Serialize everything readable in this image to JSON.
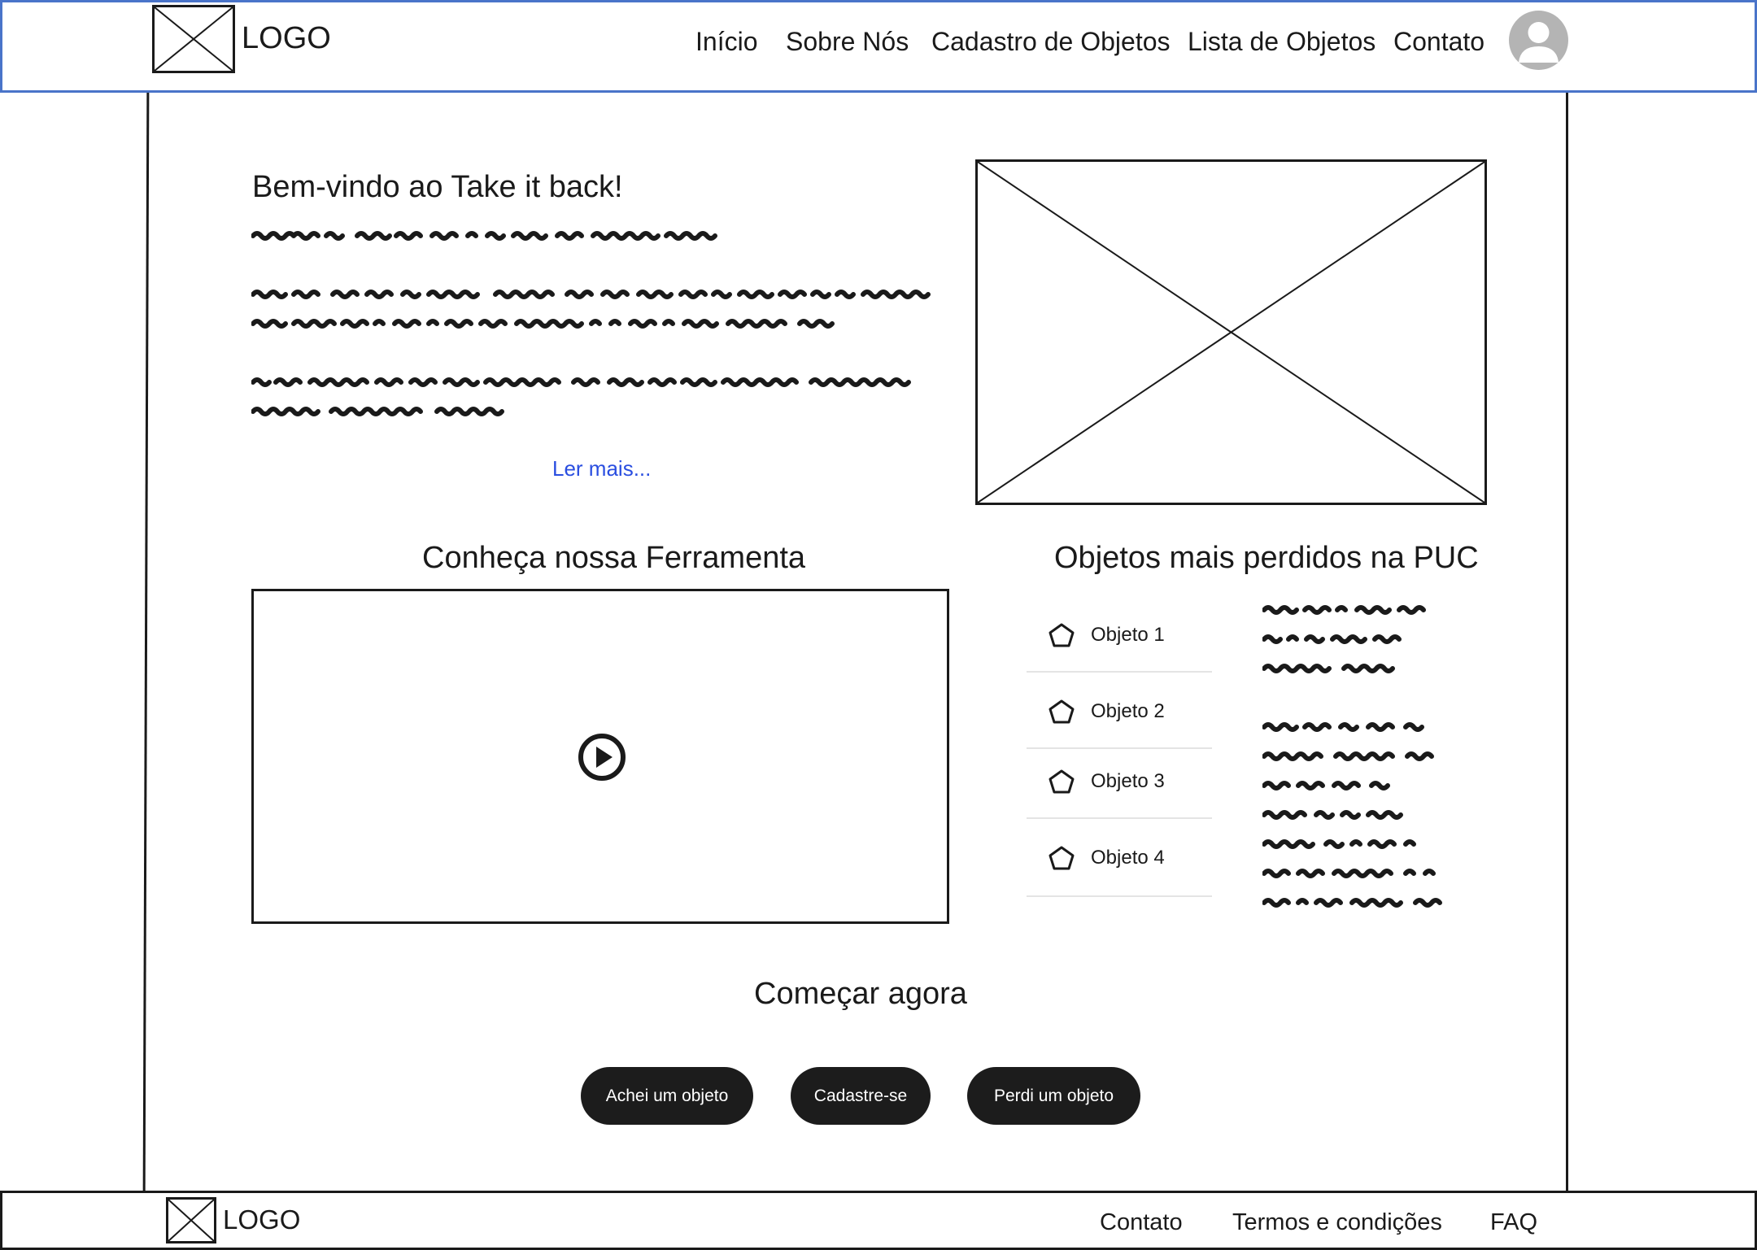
{
  "header": {
    "logo_text": "LOGO",
    "nav": [
      {
        "label": "Início"
      },
      {
        "label": "Sobre Nós"
      },
      {
        "label": "Cadastro de Objetos"
      },
      {
        "label": "Lista de Objetos"
      },
      {
        "label": "Contato"
      }
    ]
  },
  "hero": {
    "title": "Bem-vindo ao Take it back!",
    "read_more": "Ler mais..."
  },
  "tool_section": {
    "title": "Conheça nossa Ferramenta"
  },
  "lost_section": {
    "title": "Objetos mais perdidos na PUC",
    "items": [
      {
        "label": "Objeto 1"
      },
      {
        "label": "Objeto 2"
      },
      {
        "label": "Objeto 3"
      },
      {
        "label": "Objeto 4"
      }
    ]
  },
  "cta": {
    "title": "Começar agora",
    "buttons": [
      {
        "label": "Achei um objeto"
      },
      {
        "label": "Cadastre-se"
      },
      {
        "label": "Perdi um objeto"
      }
    ]
  },
  "footer": {
    "logo_text": "LOGO",
    "links": [
      {
        "label": "Contato"
      },
      {
        "label": "Termos e condições"
      },
      {
        "label": "FAQ"
      }
    ]
  },
  "colors": {
    "header_border": "#4a74c9",
    "link": "#2a4ee0",
    "button_bg": "#1c1c1c",
    "avatar": "#b4b4b4"
  }
}
